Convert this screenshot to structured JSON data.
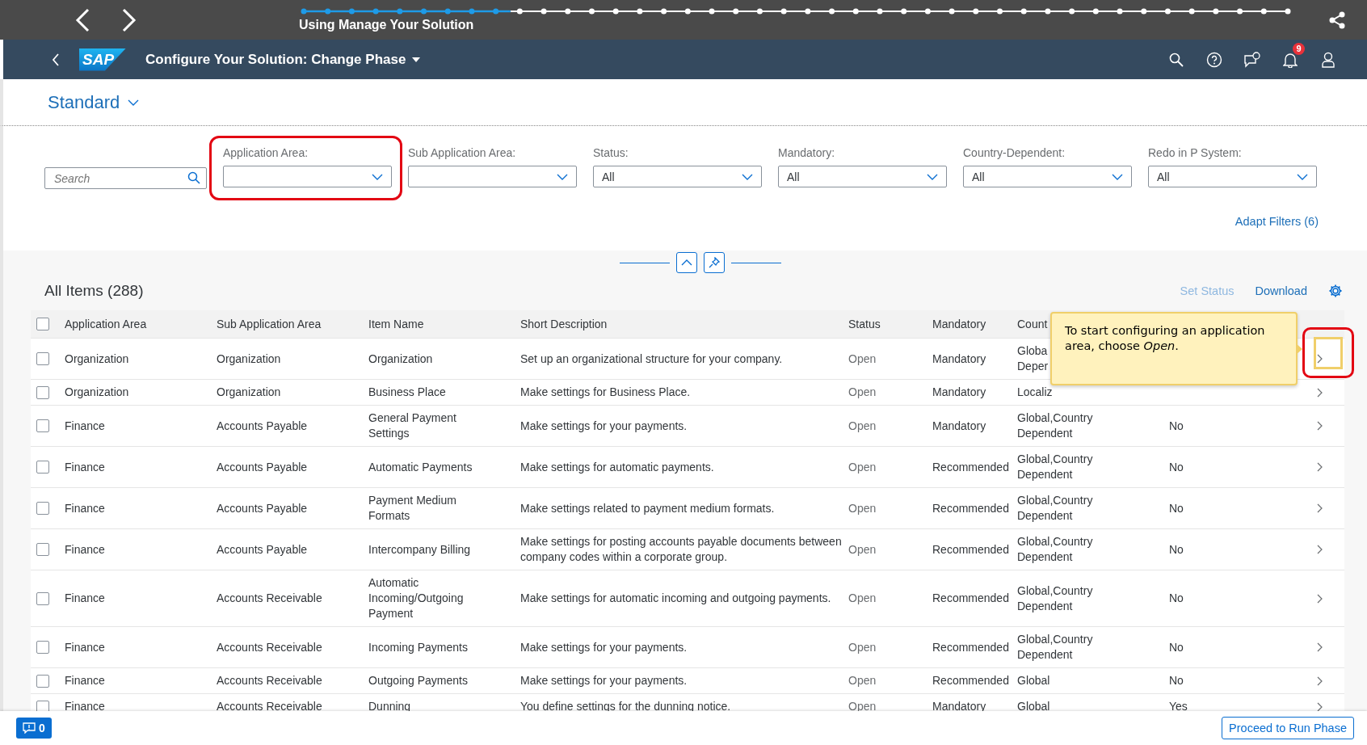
{
  "tour": {
    "title": "Using Manage Your Solution",
    "level": 0.21
  },
  "shell": {
    "logo": "SAP",
    "title": "Configure Your Solution: Change Phase",
    "notification_count": "9"
  },
  "variant": {
    "label": "Standard"
  },
  "filter_bar": {
    "search": {
      "placeholder": "Search"
    },
    "filters": [
      {
        "label": "Application Area:",
        "highlighted": true
      },
      {
        "label": "Sub Application Area:",
        "highlighted": false
      },
      {
        "label": "Status:",
        "value": "All",
        "highlighted": false
      },
      {
        "label": "Mandatory:",
        "value": "All",
        "highlighted": false
      },
      {
        "label": "Country-Dependent:",
        "value": "All",
        "highlighted": false
      },
      {
        "label": "Redo in P System:",
        "value": "All",
        "highlighted": false
      }
    ],
    "adapt_filters": "Adapt Filters (6)"
  },
  "table": {
    "title": "All Items (288)",
    "actions": [
      {
        "label": "Set Status",
        "disabled": true
      },
      {
        "label": "Download",
        "disabled": false
      }
    ],
    "select_all": {
      "checked": false
    },
    "columns": [
      "Application Area",
      "Sub Application Area",
      "Item Name",
      "Short Description",
      "Status",
      "Mandatory",
      "Count"
    ],
    "rows": [
      {
        "app_area": "Organization",
        "sub_area": "Organization",
        "item": "Organization",
        "description": "Set up an organizational structure for your company.",
        "status": "Open",
        "mandatory": "Mandatory",
        "country": "Globa\nDeper",
        "checked": false
      },
      {
        "app_area": "Organization",
        "sub_area": "Organization",
        "item": "Business Place",
        "description": "Make settings for Business Place.",
        "status": "Open",
        "mandatory": "Mandatory",
        "country": "Localiz",
        "checked": false
      },
      {
        "app_area": "Finance",
        "sub_area": "Accounts Payable",
        "item": "General Payment Settings",
        "description": "Make settings for your payments.",
        "status": "Open",
        "mandatory": "Mandatory",
        "country": "Global,Country Dependent",
        "redo": "No",
        "checked": false
      },
      {
        "app_area": "Finance",
        "sub_area": "Accounts Payable",
        "item": "Automatic Payments",
        "description": "Make settings for automatic payments.",
        "status": "Open",
        "mandatory": "Recommended",
        "country": "Global,Country Dependent",
        "redo": "No",
        "checked": false
      },
      {
        "app_area": "Finance",
        "sub_area": "Accounts Payable",
        "item": "Payment Medium Formats",
        "description": "Make settings related to payment medium formats.",
        "status": "Open",
        "mandatory": "Recommended",
        "country": "Global,Country Dependent",
        "redo": "No",
        "checked": false
      },
      {
        "app_area": "Finance",
        "sub_area": "Accounts Payable",
        "item": "Intercompany Billing",
        "description": "Make settings for posting accounts payable documents between company codes within a corporate group.",
        "status": "Open",
        "mandatory": "Recommended",
        "country": "Global,Country Dependent",
        "redo": "No",
        "checked": false
      },
      {
        "app_area": "Finance",
        "sub_area": "Accounts Receivable",
        "item": "Automatic Incoming/Outgoing Payment",
        "description": "Make settings for automatic incoming and outgoing payments.",
        "status": "Open",
        "mandatory": "Recommended",
        "country": "Global,Country Dependent",
        "redo": "No",
        "checked": false
      },
      {
        "app_area": "Finance",
        "sub_area": "Accounts Receivable",
        "item": "Incoming Payments",
        "description": "Make settings for your payments.",
        "status": "Open",
        "mandatory": "Recommended",
        "country": "Global,Country Dependent",
        "redo": "No",
        "checked": false
      },
      {
        "app_area": "Finance",
        "sub_area": "Accounts Receivable",
        "item": "Outgoing Payments",
        "description": "Make settings for your payments.",
        "status": "Open",
        "mandatory": "Recommended",
        "country": "Global",
        "redo": "No",
        "checked": false
      },
      {
        "app_area": "Finance",
        "sub_area": "Accounts Receivable",
        "item": "Dunning",
        "description": "You define settings for the dunning notice.",
        "status": "Open",
        "mandatory": "Mandatory",
        "country": "Global",
        "redo": "Yes",
        "checked": false
      }
    ]
  },
  "tooltip": {
    "text": "To start configuring an application area, choose *Open*.",
    "target_highlighted": true
  },
  "footer": {
    "messages": "0",
    "primary": "Proceed to Run Phase"
  }
}
